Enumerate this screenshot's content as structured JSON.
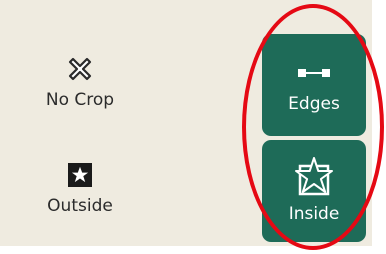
{
  "crop_options": {
    "no_crop": {
      "label": "No Crop",
      "icon": "x-crop-icon"
    },
    "outside": {
      "label": "Outside",
      "icon": "star-outside-icon"
    },
    "edges": {
      "label": "Edges",
      "icon": "edges-line-icon",
      "selected": true
    },
    "inside": {
      "label": "Inside",
      "icon": "star-inside-icon",
      "selected": true
    }
  },
  "colors": {
    "ribbon_bg": "#efebe0",
    "selected_bg": "#1e6b58",
    "highlight_ring": "#e50914"
  }
}
